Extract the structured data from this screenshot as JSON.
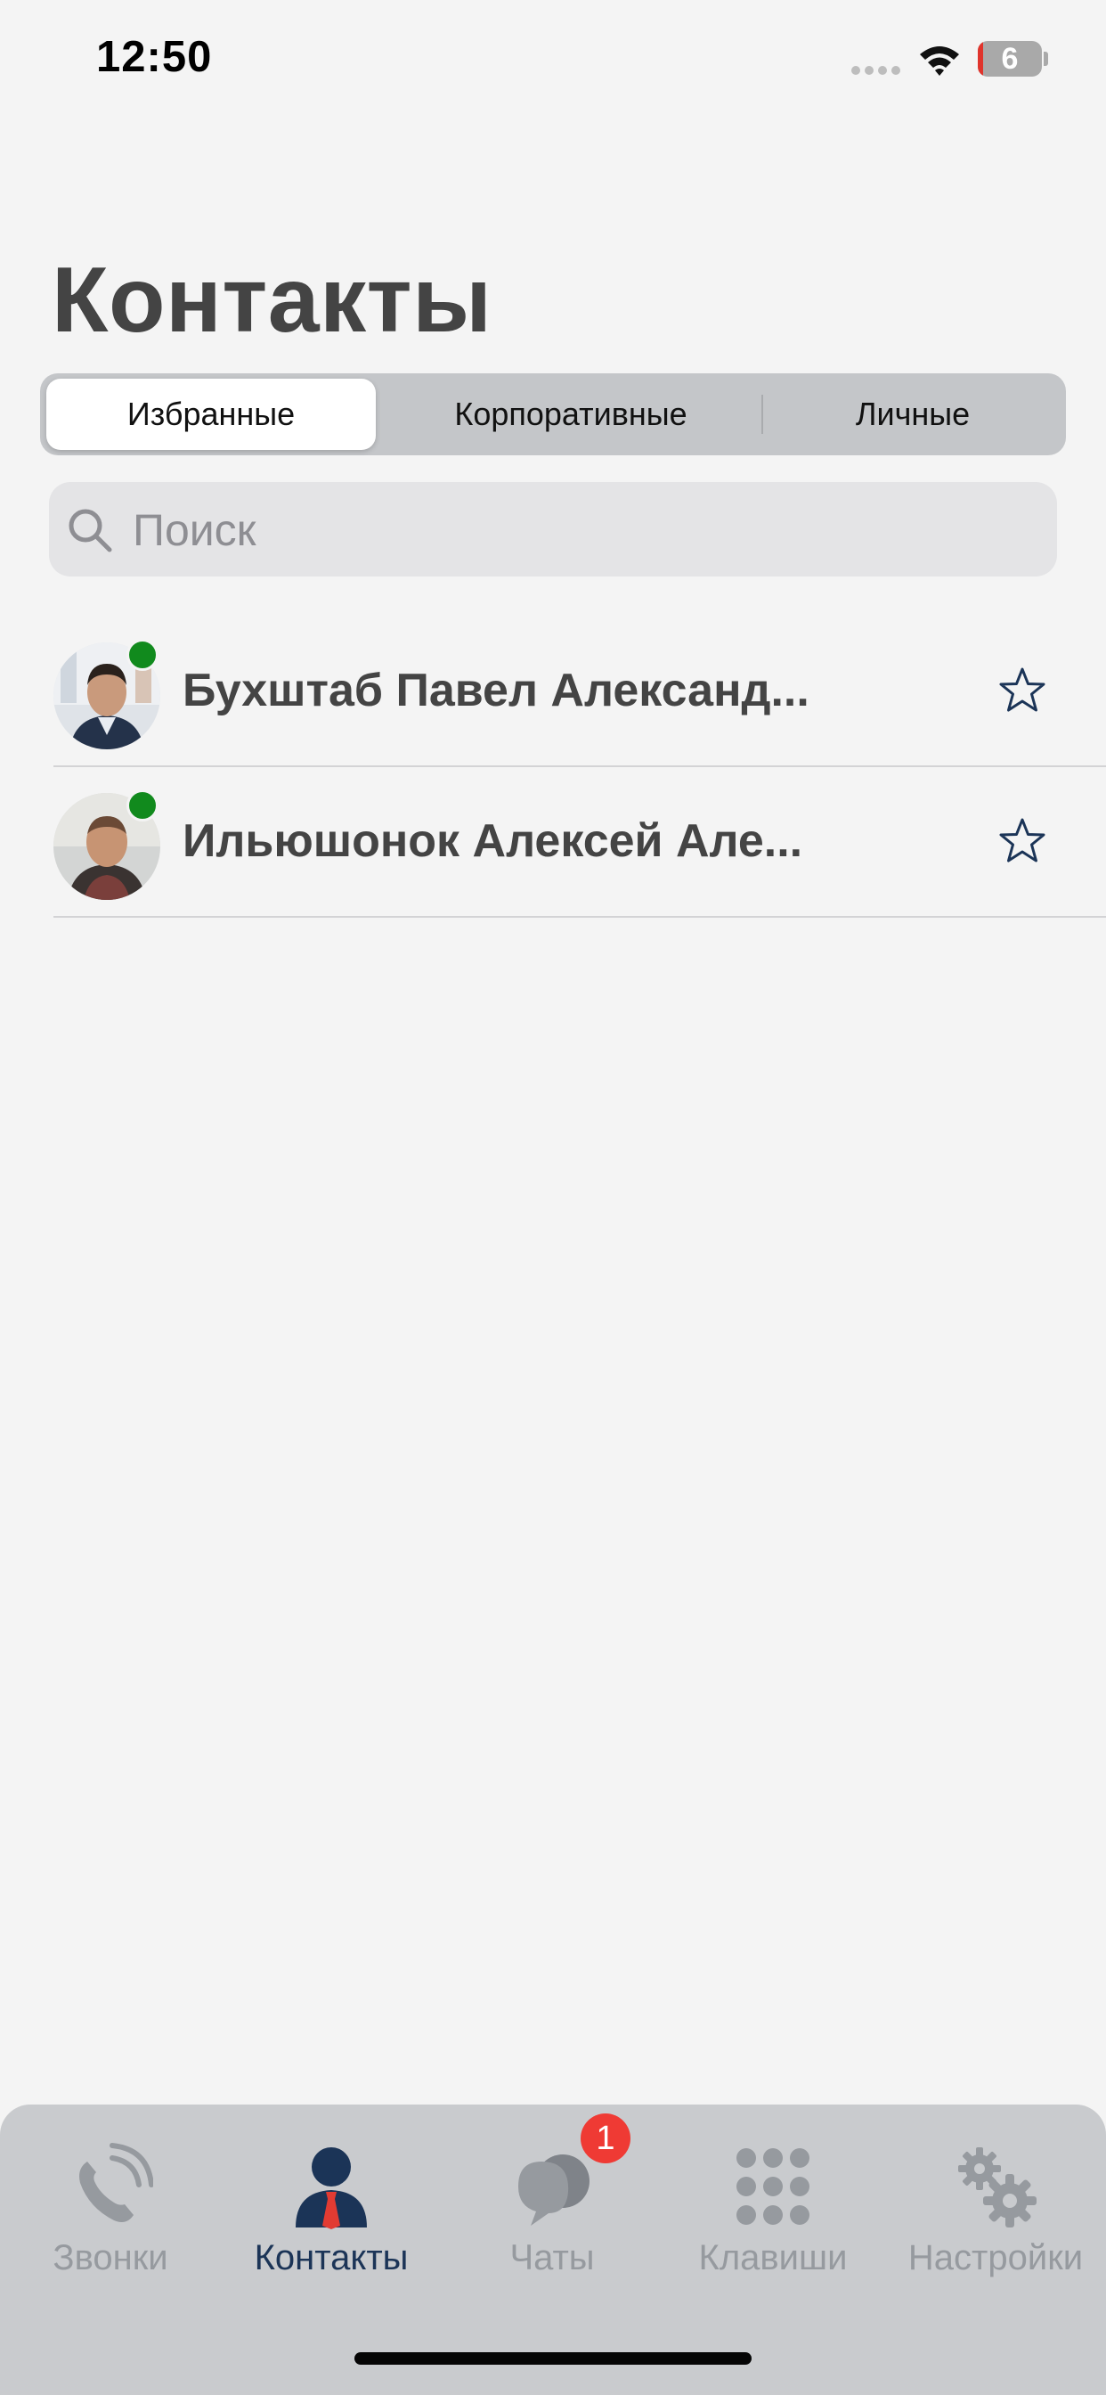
{
  "status_bar": {
    "time": "12:50",
    "battery_level": "6"
  },
  "header": {
    "title": "Контакты"
  },
  "segmented_control": {
    "segments": [
      {
        "label": "Избранные",
        "selected": true
      },
      {
        "label": "Корпоративные",
        "selected": false
      },
      {
        "label": "Личные",
        "selected": false
      }
    ]
  },
  "search": {
    "placeholder": "Поиск",
    "value": ""
  },
  "contacts": [
    {
      "name": "Бухштаб Павел Александ...",
      "status": "online",
      "favorite": true
    },
    {
      "name": "Ильюшонок Алексей Але...",
      "status": "online",
      "favorite": true
    }
  ],
  "tab_bar": {
    "tabs": [
      {
        "label": "Звонки",
        "icon": "phone-icon",
        "active": false
      },
      {
        "label": "Контакты",
        "icon": "person-icon",
        "active": true
      },
      {
        "label": "Чаты",
        "icon": "chat-bubbles-icon",
        "active": false,
        "badge": "1"
      },
      {
        "label": "Клавиши",
        "icon": "keypad-icon",
        "active": false
      },
      {
        "label": "Настройки",
        "icon": "gears-icon",
        "active": false
      }
    ]
  },
  "colors": {
    "background": "#f4f4f4",
    "accent": "#1b3457",
    "presence_online": "#118a1d",
    "badge": "#ef3a34",
    "tab_inactive": "#969a9f"
  }
}
